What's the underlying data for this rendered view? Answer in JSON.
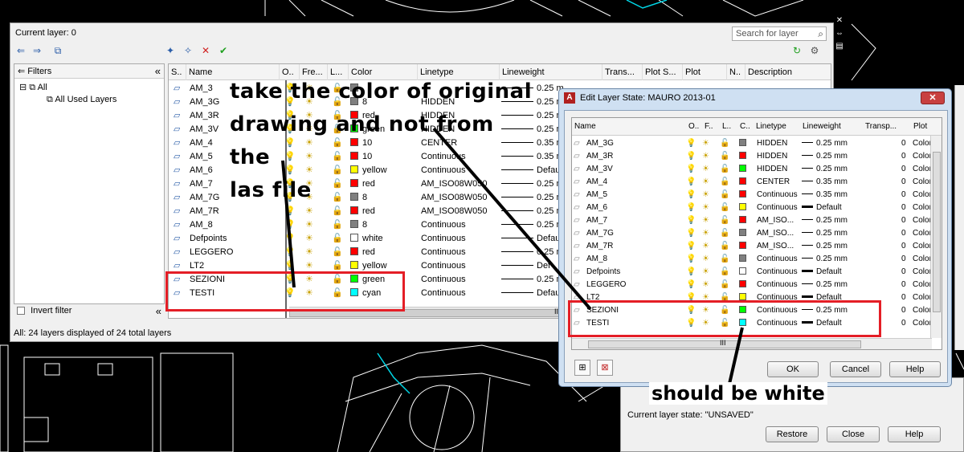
{
  "layer_manager": {
    "current_layer": "Current layer: 0",
    "search_placeholder": "Search for layer",
    "filters_label": "Filters",
    "tree": {
      "all": "All",
      "all_used": "All Used Layers"
    },
    "invert_filter": "Invert filter",
    "status": "All: 24 layers displayed of 24 total layers",
    "scroll_label": "III",
    "columns": [
      "S..",
      "Name",
      "O..",
      "Fre...",
      "L...",
      "Color",
      "Linetype",
      "Lineweight",
      "Trans...",
      "Plot S...",
      "Plot",
      "N..",
      "Description"
    ],
    "rows": [
      {
        "name": "AM_3",
        "color_name": "",
        "color": "#808080",
        "linetype": "",
        "lineweight": "0.25 m"
      },
      {
        "name": "AM_3G",
        "color_name": "8",
        "color": "#808080",
        "linetype": "HIDDEN",
        "lineweight": "0.25 m"
      },
      {
        "name": "AM_3R",
        "color_name": "red",
        "color": "#ff0000",
        "linetype": "HIDDEN",
        "lineweight": "0.25 m"
      },
      {
        "name": "AM_3V",
        "color_name": "green",
        "color": "#00ff00",
        "linetype": "HIDDEN",
        "lineweight": "0.25 m"
      },
      {
        "name": "AM_4",
        "color_name": "10",
        "color": "#ff0000",
        "linetype": "CENTER",
        "lineweight": "0.35 m"
      },
      {
        "name": "AM_5",
        "color_name": "10",
        "color": "#ff0000",
        "linetype": "Continuous",
        "lineweight": "0.35 m"
      },
      {
        "name": "AM_6",
        "color_name": "yellow",
        "color": "#ffff00",
        "linetype": "Continuous",
        "lineweight": "Defau"
      },
      {
        "name": "AM_7",
        "color_name": "red",
        "color": "#ff0000",
        "linetype": "AM_ISO08W050",
        "lineweight": "0.25 m"
      },
      {
        "name": "AM_7G",
        "color_name": "8",
        "color": "#808080",
        "linetype": "AM_ISO08W050",
        "lineweight": "0.25 m"
      },
      {
        "name": "AM_7R",
        "color_name": "red",
        "color": "#ff0000",
        "linetype": "AM_ISO08W050",
        "lineweight": "0.25 m"
      },
      {
        "name": "AM_8",
        "color_name": "8",
        "color": "#808080",
        "linetype": "Continuous",
        "lineweight": "0.25 m"
      },
      {
        "name": "Defpoints",
        "color_name": "white",
        "color": "#ffffff",
        "linetype": "Continuous",
        "lineweight": "Defau"
      },
      {
        "name": "LEGGERO",
        "color_name": "red",
        "color": "#ff0000",
        "linetype": "Continuous",
        "lineweight": "0.25 m"
      },
      {
        "name": "LT2",
        "color_name": "yellow",
        "color": "#ffff00",
        "linetype": "Continuous",
        "lineweight": "Def"
      },
      {
        "name": "SEZIONI",
        "color_name": "green",
        "color": "#00ff00",
        "linetype": "Continuous",
        "lineweight": "0.25 m"
      },
      {
        "name": "TESTI",
        "color_name": "cyan",
        "color": "#00ffff",
        "linetype": "Continuous",
        "lineweight": "Defau"
      }
    ]
  },
  "edit_layer_state": {
    "title": "Edit Layer State: MAURO 2013-01",
    "columns": [
      "Name",
      "O..",
      "F..",
      "L..",
      "C..",
      "Linetype",
      "Lineweight",
      "Transp...",
      "Plot"
    ],
    "rows": [
      {
        "name": "AM_3G",
        "color": "#808080",
        "linetype": "HIDDEN",
        "lineweight": "0.25 mm",
        "transp": "0",
        "plot": "Color"
      },
      {
        "name": "AM_3R",
        "color": "#ff0000",
        "linetype": "HIDDEN",
        "lineweight": "0.25 mm",
        "transp": "0",
        "plot": "Color"
      },
      {
        "name": "AM_3V",
        "color": "#00ff00",
        "linetype": "HIDDEN",
        "lineweight": "0.25 mm",
        "transp": "0",
        "plot": "Color"
      },
      {
        "name": "AM_4",
        "color": "#ff0000",
        "linetype": "CENTER",
        "lineweight": "0.35 mm",
        "transp": "0",
        "plot": "Color"
      },
      {
        "name": "AM_5",
        "color": "#ff0000",
        "linetype": "Continuous",
        "lineweight": "0.35 mm",
        "transp": "0",
        "plot": "Color"
      },
      {
        "name": "AM_6",
        "color": "#ffff00",
        "linetype": "Continuous",
        "lineweight": "Default",
        "transp": "0",
        "plot": "Color"
      },
      {
        "name": "AM_7",
        "color": "#ff0000",
        "linetype": "AM_ISO...",
        "lineweight": "0.25 mm",
        "transp": "0",
        "plot": "Color"
      },
      {
        "name": "AM_7G",
        "color": "#808080",
        "linetype": "AM_ISO...",
        "lineweight": "0.25 mm",
        "transp": "0",
        "plot": "Color"
      },
      {
        "name": "AM_7R",
        "color": "#ff0000",
        "linetype": "AM_ISO...",
        "lineweight": "0.25 mm",
        "transp": "0",
        "plot": "Color"
      },
      {
        "name": "AM_8",
        "color": "#808080",
        "linetype": "Continuous",
        "lineweight": "0.25 mm",
        "transp": "0",
        "plot": "Color"
      },
      {
        "name": "Defpoints",
        "color": "#ffffff",
        "linetype": "Continuous",
        "lineweight": "Default",
        "transp": "0",
        "plot": "Color"
      },
      {
        "name": "LEGGERO",
        "color": "#ff0000",
        "linetype": "Continuous",
        "lineweight": "0.25 mm",
        "transp": "0",
        "plot": "Color"
      },
      {
        "name": "LT2",
        "color": "#ffff00",
        "linetype": "Continuous",
        "lineweight": "Default",
        "transp": "0",
        "plot": "Color"
      },
      {
        "name": "SEZIONI",
        "color": "#00ff00",
        "linetype": "Continuous",
        "lineweight": "0.25 mm",
        "transp": "0",
        "plot": "Color"
      },
      {
        "name": "TESTI",
        "color": "#00ffff",
        "linetype": "Continuous",
        "lineweight": "Default",
        "transp": "0",
        "plot": "Color"
      }
    ],
    "scroll_label": "III",
    "ok": "OK",
    "cancel": "Cancel",
    "help": "Help"
  },
  "restore_dialog": {
    "state": "Current layer state: \"UNSAVED\"",
    "restore": "Restore",
    "close": "Close",
    "help": "Help"
  },
  "annotations": {
    "top_lines": [
      "take the color of original",
      "drawing and not from the",
      "las file"
    ],
    "bottom": "should be white",
    "annotation_color": "#e41e26"
  }
}
